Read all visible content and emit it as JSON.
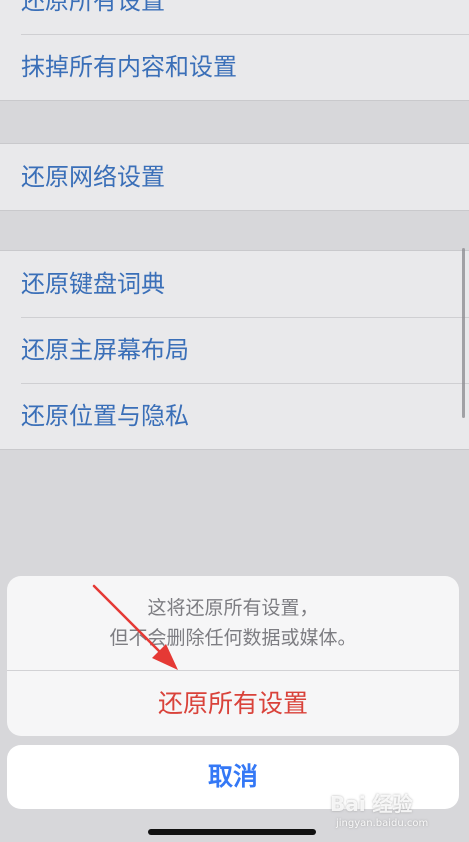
{
  "settings_list": {
    "group1": [
      {
        "label": "还原所有设置"
      },
      {
        "label": "抹掉所有内容和设置"
      }
    ],
    "group2": [
      {
        "label": "还原网络设置"
      }
    ],
    "group3": [
      {
        "label": "还原键盘词典"
      },
      {
        "label": "还原主屏幕布局"
      },
      {
        "label": "还原位置与隐私"
      }
    ]
  },
  "action_sheet": {
    "message_line1": "这将还原所有设置，",
    "message_line2": "但不会删除任何数据或媒体。",
    "confirm_label": "还原所有设置",
    "cancel_label": "取消"
  },
  "colors": {
    "link_blue": "#3a6fb8",
    "destructive_red": "#d9423a",
    "cancel_blue": "#3478f6",
    "annotation_arrow": "#e53935"
  },
  "watermark": {
    "logo_text": "Bai 经验",
    "url": "jingyan.baidu.com"
  }
}
